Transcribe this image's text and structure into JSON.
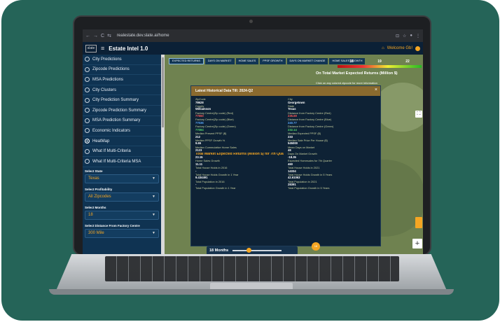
{
  "browser": {
    "url": "realestate.dev.slate.ai/home",
    "back": "←",
    "forward": "→",
    "reload": "C",
    "lock": "⇆"
  },
  "app": {
    "logo": "slate",
    "title": "Estate Intel 1.0",
    "welcome": "Welcome Gb!"
  },
  "sidebar": {
    "items": [
      {
        "label": "City Predictions",
        "selected": false
      },
      {
        "label": "Zipcode Predictions",
        "selected": false
      },
      {
        "label": "MSA Predictions",
        "selected": false
      },
      {
        "label": "City Clusters",
        "selected": false
      },
      {
        "label": "City Prediction Summary",
        "selected": false
      },
      {
        "label": "Zipcode Prediction Summary",
        "selected": false
      },
      {
        "label": "MSA Prediction Summary",
        "selected": false
      },
      {
        "label": "Economic Indicators",
        "selected": false
      },
      {
        "label": "HeatMap",
        "selected": true
      },
      {
        "label": "What If Multi-Criteria",
        "selected": false
      },
      {
        "label": "What If Multi-Criteria MSA",
        "selected": false
      }
    ],
    "filters": {
      "state": {
        "label": "Select State",
        "value": "Texas"
      },
      "profitability": {
        "label": "Select Profitability",
        "value": "All Zipcodes"
      },
      "months": {
        "label": "Select Months",
        "value": "18"
      },
      "distance": {
        "label": "Select Distance From Factory Centre",
        "value": "300 Mile"
      }
    }
  },
  "map": {
    "tabs": [
      "EXPECTED RETURNS",
      "DAYS ON MARKET",
      "HOME SALES",
      "PPSF GROWTH",
      "DAYS ON MARKET CHANGE",
      "HOME SALES GROWTH"
    ],
    "legend": [
      "16",
      "19",
      "22"
    ],
    "title": "On Total Market Expected Returns (Million $)",
    "hint": "Click on any colored zipcode for more information",
    "zoom_in": "+",
    "fullscreen": "⛶",
    "slider": {
      "label": "18 Months",
      "badge": "18"
    }
  },
  "popup": {
    "header": "Latest Historical Data Till: 2024-Q2",
    "close": "×",
    "fields": [
      {
        "label": "ZipCode",
        "value": "78628",
        "color": ""
      },
      {
        "label": "City",
        "value": "Georgetown",
        "color": ""
      },
      {
        "label": "County",
        "value": "Williamson",
        "color": ""
      },
      {
        "label": "State",
        "value": "Texas",
        "color": ""
      },
      {
        "label": "Factory Centre(Zip code) (Red)",
        "value": "77550",
        "color": "r"
      },
      {
        "label": "Distance from Factory Centre (Red)",
        "value": "235.69",
        "color": "r"
      },
      {
        "label": "Factory Centre(Zip code) (Blue)",
        "value": "77036",
        "color": "b"
      },
      {
        "label": "Distance from Factory Centre (Blue)",
        "value": "240.77",
        "color": "b"
      },
      {
        "label": "Factory Centre(Zip code) (Green)",
        "value": "77084",
        "color": "g"
      },
      {
        "label": "Distance from Factory Centre (Green)",
        "value": "232.14",
        "color": "g"
      },
      {
        "label": "Median Present PPSF ($)",
        "value": "212",
        "color": ""
      },
      {
        "label": "Median Expected PPSF ($)",
        "value": "233",
        "color": ""
      },
      {
        "label": "Median PPSF Growth %",
        "value": "9.65",
        "color": ""
      },
      {
        "label": "Median Sale Price Per House ($)",
        "value": "545000",
        "color": ""
      },
      {
        "label": "Median Cummulative Home Sales",
        "value": "2123",
        "color": ""
      },
      {
        "label": "Mean Days on Market",
        "value": "48",
        "color": ""
      },
      {
        "label": "Total Market Expected Returns (Million $) for 7th Quarter",
        "value": "23.15",
        "color": "",
        "big": true
      },
      {
        "label": "Days On Market Growth",
        "value": "-18.35",
        "color": ""
      },
      {
        "label": "Home Sales Growth",
        "value": "11.11",
        "color": ""
      },
      {
        "label": "Expected Homesales for 7th Quarter",
        "value": "460",
        "color": ""
      },
      {
        "label": "Total House Holds in 2016",
        "value": "-",
        "color": ""
      },
      {
        "label": "Total House Holds in 2021",
        "value": "14334",
        "color": ""
      },
      {
        "label": "Total House Holds Growth in 1 Year",
        "value": "9.434491",
        "color": ""
      },
      {
        "label": "Total House Holds Growth in 5 Years",
        "value": "42.61063",
        "color": ""
      },
      {
        "label": "Total Population in 2016",
        "value": "-",
        "color": ""
      },
      {
        "label": "Total Population in 2021",
        "value": "28391",
        "color": ""
      },
      {
        "label": "Total Population Growth in 1 Year",
        "value": "",
        "color": ""
      },
      {
        "label": "Total Population Growth in 5 Years",
        "value": "",
        "color": ""
      }
    ]
  }
}
